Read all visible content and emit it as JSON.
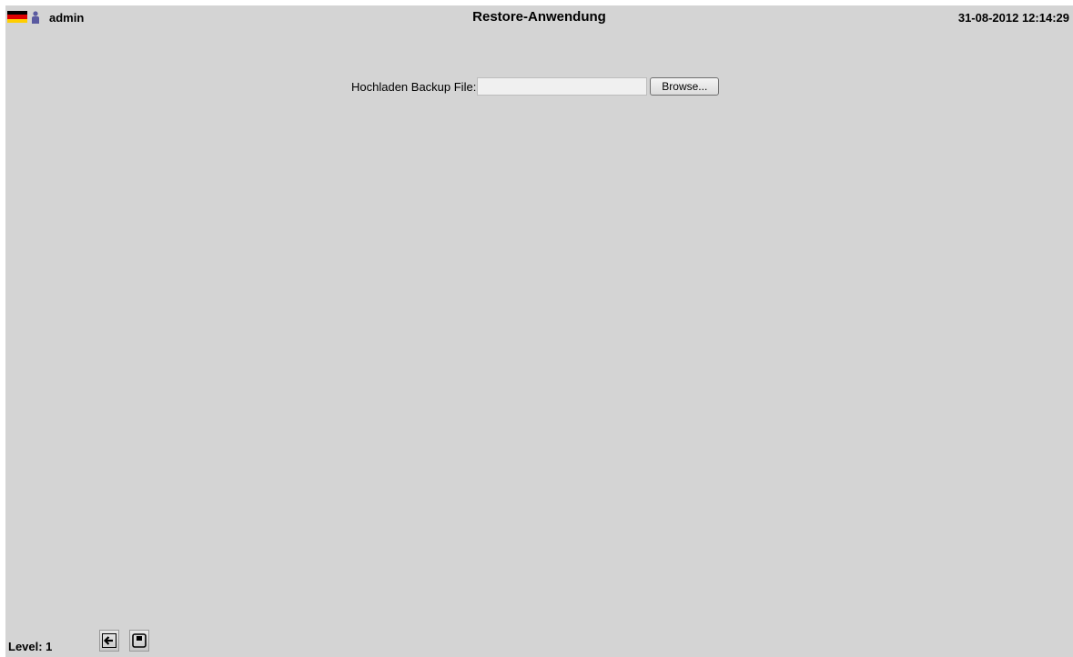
{
  "header": {
    "username": "admin",
    "title": "Restore-Anwendung",
    "datetime": "31-08-2012 12:14:29",
    "flag_icon": "germany-flag-icon",
    "user_icon": "user-icon"
  },
  "upload": {
    "label": "Hochladen Backup File:",
    "file_value": "",
    "browse_label": "Browse..."
  },
  "footer": {
    "level_label": "Level: 1",
    "buttons": [
      {
        "icon": "back-arrow-icon"
      },
      {
        "icon": "save-icon"
      }
    ]
  },
  "colors": {
    "background": "#d4d4d4",
    "flag": [
      "#000000",
      "#dd0000",
      "#ffce00"
    ],
    "user_icon": "#5a5aa0"
  }
}
